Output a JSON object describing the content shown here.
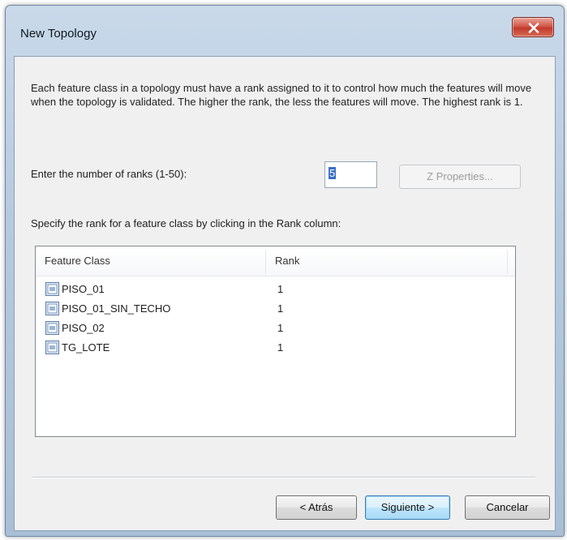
{
  "window": {
    "title": "New Topology"
  },
  "description": "Each feature class in a topology must have a rank assigned to it to control how much the features will move when the topology is validated. The higher the rank, the less the features will move. The highest rank is 1.",
  "ranks": {
    "label": "Enter the number of ranks  (1-50):",
    "value": "5",
    "z_properties_label": "Z Properties..."
  },
  "specify_label": "Specify the rank for a feature class by clicking in the Rank column:",
  "table": {
    "columns": [
      "Feature Class",
      "Rank"
    ],
    "rows": [
      {
        "name": "PISO_01",
        "rank": "1",
        "icon": "feature-class-icon"
      },
      {
        "name": "PISO_01_SIN_TECHO",
        "rank": "1",
        "icon": "feature-class-icon"
      },
      {
        "name": "PISO_02",
        "rank": "1",
        "icon": "feature-class-icon"
      },
      {
        "name": "TG_LOTE",
        "rank": "1",
        "icon": "feature-class-icon"
      }
    ]
  },
  "buttons": {
    "back": "< Atrás",
    "next": "Siguiente >",
    "cancel": "Cancelar"
  },
  "colors": {
    "close_button": "#c9463a",
    "default_button_border": "#3c7fb1",
    "selection": "#3a6ec8"
  }
}
